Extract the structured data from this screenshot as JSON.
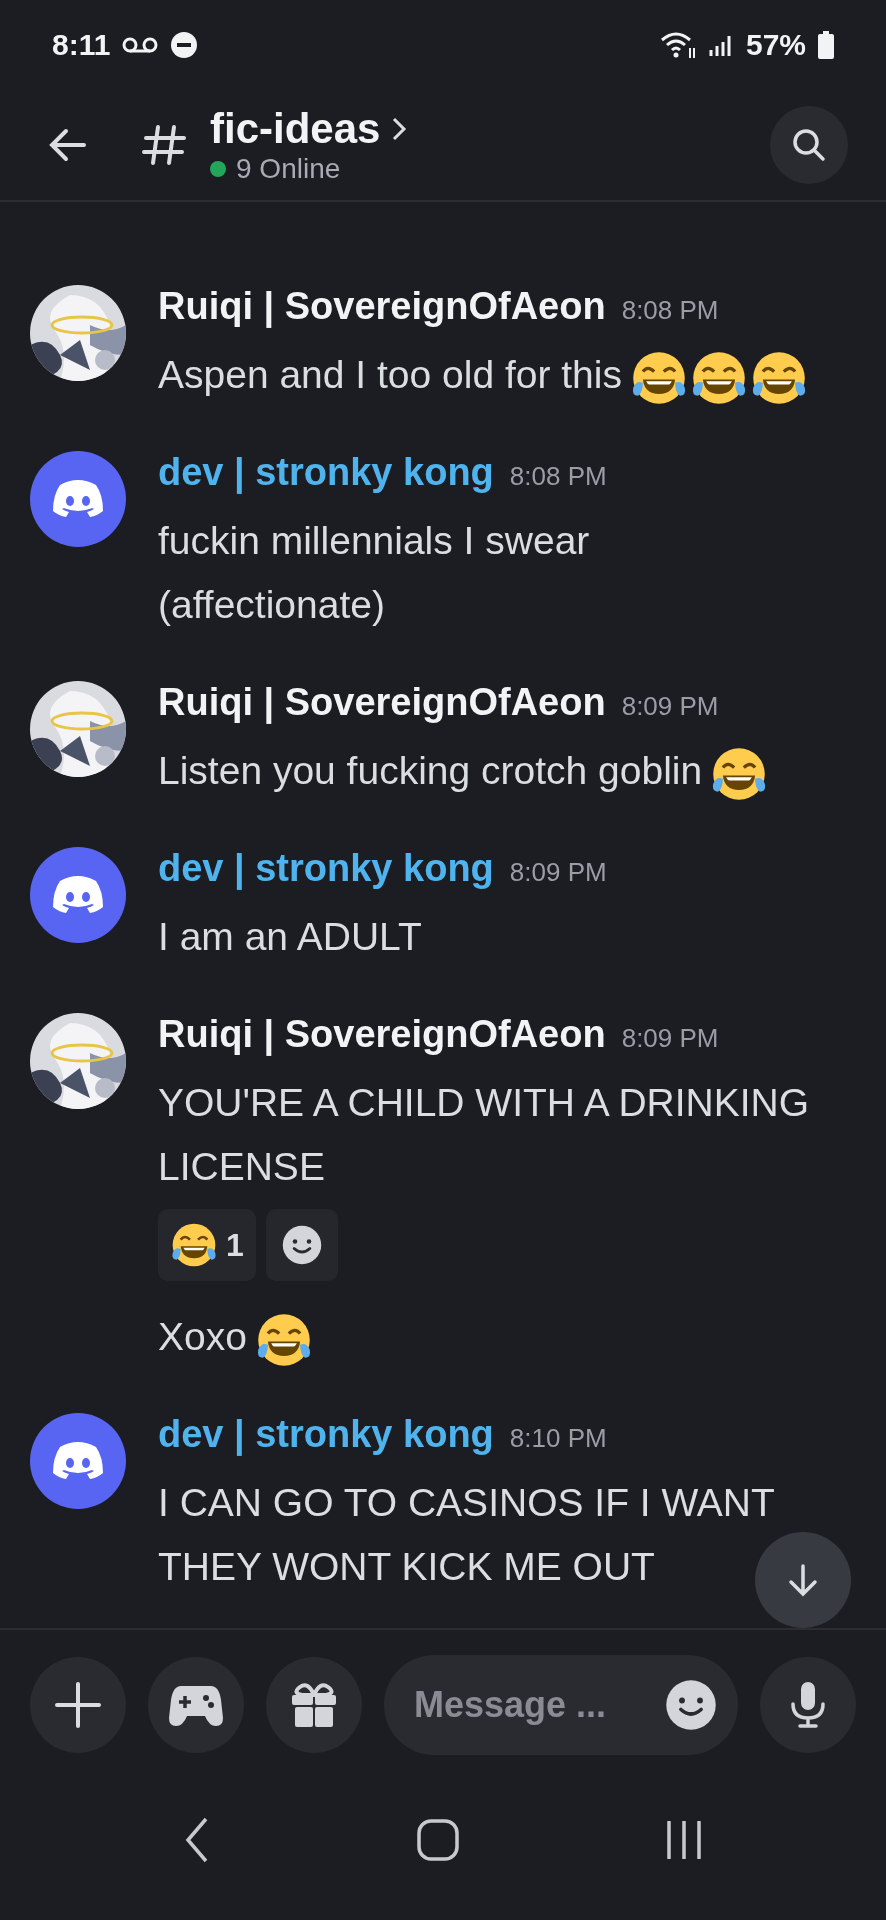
{
  "status_bar": {
    "time": "8:11",
    "battery": "57%"
  },
  "header": {
    "channel": "fic-ideas",
    "online": "9 Online"
  },
  "messages": [
    {
      "author": "Ruiqi | SovereignOfAeon",
      "color": "#f2f3f5",
      "avatar": {
        "kind": "picture"
      },
      "time": "8:08 PM",
      "lines": [
        {
          "text": "Aspen and I too old for this",
          "emoji": [
            {
              "kind": "laugh"
            },
            {
              "kind": "laugh"
            },
            {
              "kind": "laugh"
            }
          ]
        }
      ]
    },
    {
      "author": "dev | stronky kong",
      "color": "#4fb4ee",
      "avatar": {
        "kind": "default"
      },
      "time": "8:08 PM",
      "lines": [
        {
          "text": "fuckin millennials I swear (affectionate)"
        }
      ]
    },
    {
      "author": "Ruiqi | SovereignOfAeon",
      "color": "#f2f3f5",
      "avatar": {
        "kind": "picture"
      },
      "time": "8:09 PM",
      "lines": [
        {
          "text": "Listen you fucking crotch goblin",
          "emoji": [
            {
              "kind": "laugh"
            }
          ]
        }
      ]
    },
    {
      "author": "dev | stronky kong",
      "color": "#4fb4ee",
      "avatar": {
        "kind": "default"
      },
      "time": "8:09 PM",
      "lines": [
        {
          "text": "I am an ADULT"
        }
      ]
    },
    {
      "author": "Ruiqi | SovereignOfAeon",
      "color": "#f2f3f5",
      "avatar": {
        "kind": "picture"
      },
      "time": "8:09 PM",
      "lines": [
        {
          "text": "YOU'RE A CHILD WITH A DRINKING LICENSE",
          "reactions": [
            {
              "count": "1"
            }
          ]
        },
        {
          "text": "Xoxo",
          "emoji": [
            {
              "kind": "laugh"
            }
          ]
        }
      ]
    },
    {
      "author": "dev | stronky kong",
      "color": "#4fb4ee",
      "avatar": {
        "kind": "default"
      },
      "time": "8:10 PM",
      "lines": [
        {
          "text": "I CAN GO TO CASINOS IF I WANT THEY WONT KICK ME OUT"
        }
      ]
    }
  ],
  "composer": {
    "placeholder": "Message ..."
  }
}
